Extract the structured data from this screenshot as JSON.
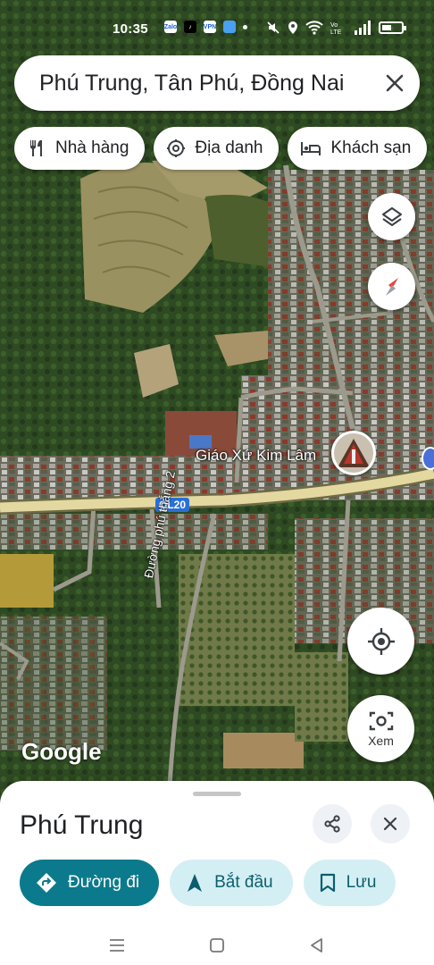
{
  "status_bar": {
    "time": "10:35",
    "icons": [
      "zalo-icon",
      "tiktok-icon",
      "vpn-icon",
      "app-icon",
      "dot-icon",
      "mute-icon",
      "location-icon",
      "wifi-icon",
      "volte-icon",
      "signal-icon",
      "battery-icon"
    ],
    "app_labels": [
      "Zalo",
      "♪",
      "VPN",
      ""
    ]
  },
  "search": {
    "query": "Phú Trung, Tân Phú, Đồng Nai"
  },
  "chips": [
    {
      "label": "Nhà hàng",
      "icon": "restaurant-icon"
    },
    {
      "label": "Địa danh",
      "icon": "landmark-icon"
    },
    {
      "label": "Khách sạn",
      "icon": "hotel-icon"
    }
  ],
  "map": {
    "place_label": "Giáo Xứ Kim Lâm",
    "road_shield": "QL20",
    "road_name": "Đường phú thắng 2",
    "logo": "Google",
    "lens_label": "Xem"
  },
  "sheet": {
    "title": "Phú Trung",
    "actions": [
      {
        "label": "Đường đi",
        "icon": "directions-icon",
        "style": "primary"
      },
      {
        "label": "Bắt đầu",
        "icon": "navigation-icon",
        "style": "secondary"
      },
      {
        "label": "Lưu",
        "icon": "bookmark-icon",
        "style": "secondary"
      }
    ]
  },
  "colors": {
    "primary_action": "#0b7a8c",
    "secondary_action": "#d4eff3",
    "compass_red": "#e8453c"
  }
}
